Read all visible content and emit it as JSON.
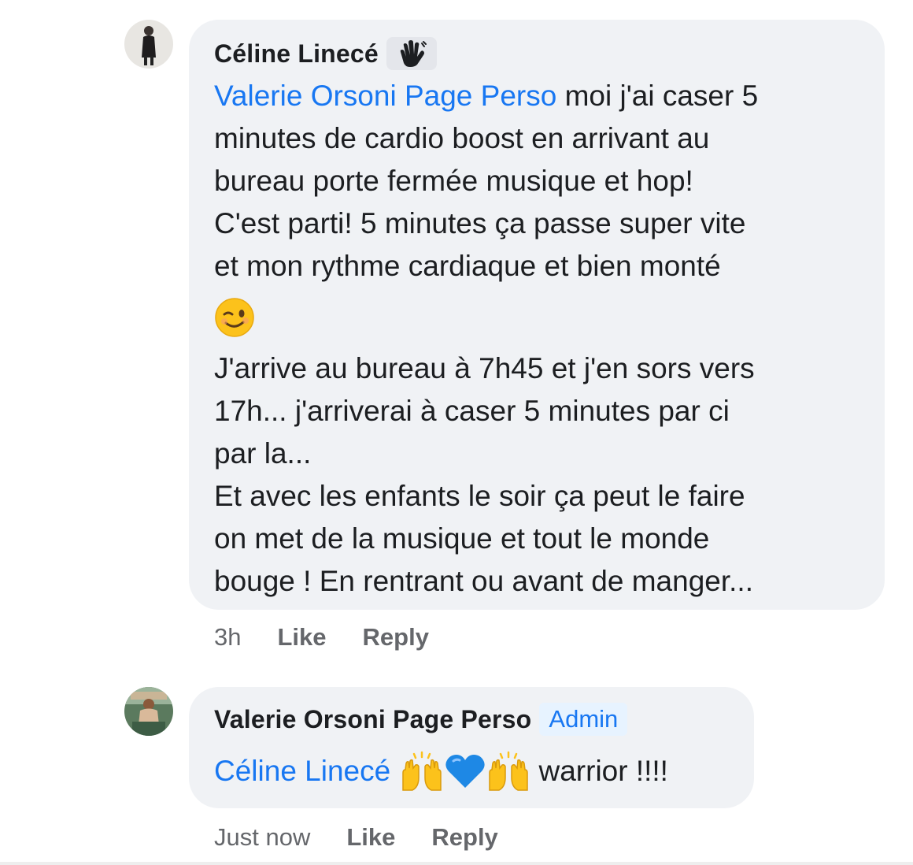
{
  "comments": [
    {
      "author": "Céline Linecé",
      "author_badge_icon": "waving-hand-icon",
      "lines": {
        "l1_mention": "Valerie Orsoni Page Perso",
        "l1_text": " moi j'ai caser 5",
        "l2": "minutes de cardio boost en arrivant au",
        "l3": "bureau porte fermée musique et hop!",
        "l4": "C'est parti! 5 minutes ça passe super vite",
        "l5": "et mon rythme cardiaque et bien monté",
        "emoji": "winking-face-emoji",
        "l6": "J'arrive au bureau à 7h45 et j'en sors vers",
        "l7": "17h... j'arriverai à caser 5 minutes par ci",
        "l8": "par la...",
        "l9": "Et avec les enfants le soir ça peut le faire",
        "l10": "on met de la musique et tout le monde",
        "l11": "bouge ! En rentrant ou avant de manger..."
      },
      "time": "3h",
      "like_label": "Like",
      "reply_label": "Reply"
    },
    {
      "author": "Valerie Orsoni Page Perso",
      "admin_label": "Admin",
      "mention": "Céline Linecé",
      "emojis": [
        "raising-hands-emoji",
        "blue-heart-emoji",
        "raising-hands-emoji"
      ],
      "text": " warrior !!!!",
      "time": "Just now",
      "like_label": "Like",
      "reply_label": "Reply"
    }
  ],
  "colors": {
    "bubble": "#f0f2f5",
    "mention": "#1877f2",
    "text": "#1c1e21",
    "meta": "#65676b",
    "admin_badge_bg": "#e7f3ff"
  }
}
